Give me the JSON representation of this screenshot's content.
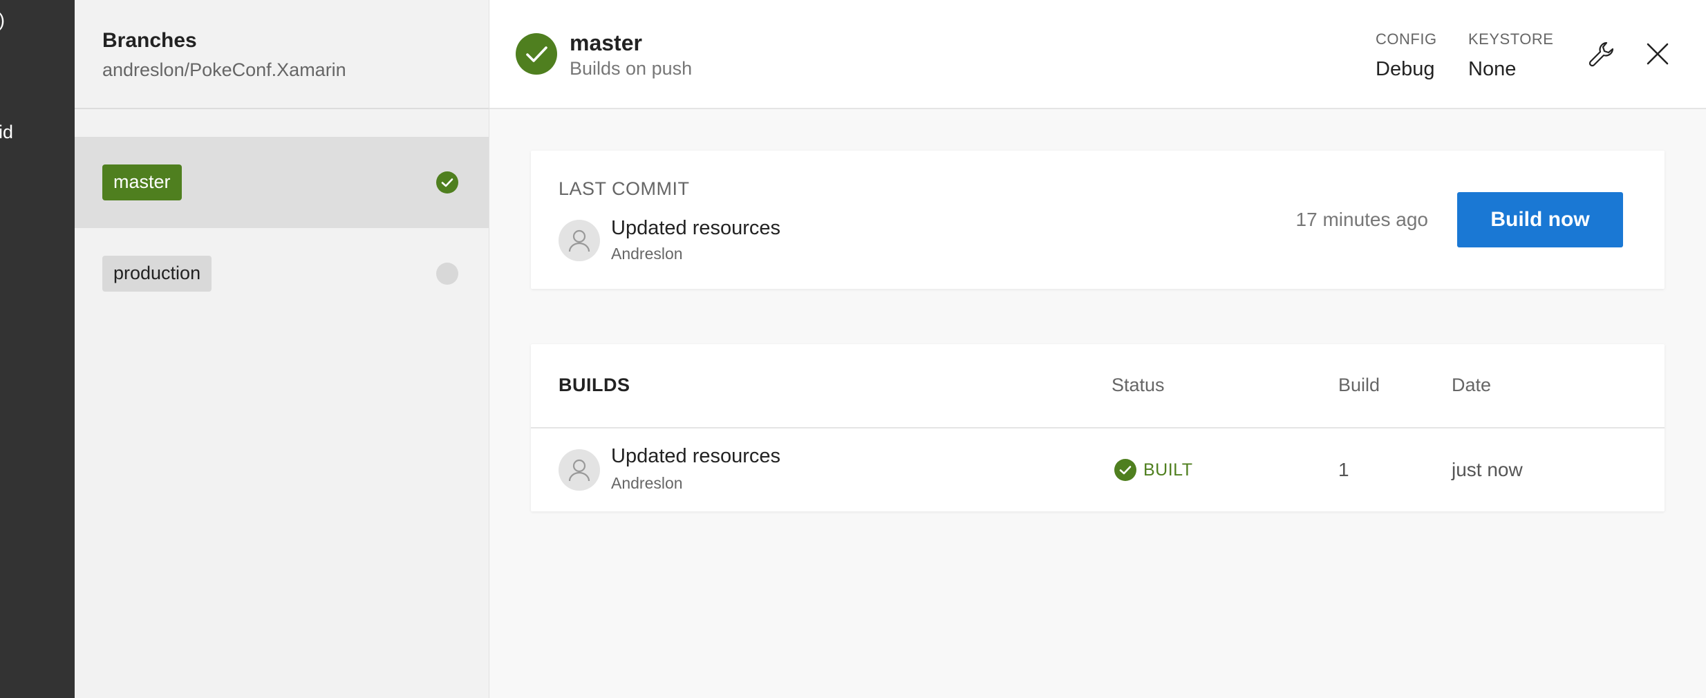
{
  "left_nav": {
    "fragment_1": ")",
    "fragment_2": "id"
  },
  "branches_panel": {
    "title": "Branches",
    "repo": "andreslon/PokeConf.Xamarin",
    "items": [
      {
        "name": "master",
        "status": "success",
        "selected": true
      },
      {
        "name": "production",
        "status": "none",
        "selected": false
      }
    ]
  },
  "header": {
    "branch": "master",
    "subtitle": "Builds on push",
    "config_label": "CONFIG",
    "config_value": "Debug",
    "keystore_label": "KEYSTORE",
    "keystore_value": "None",
    "icons": {
      "settings": "wrench-icon",
      "close": "close-icon",
      "status": "check-circle-icon"
    }
  },
  "last_commit": {
    "label": "LAST COMMIT",
    "message": "Updated resources",
    "author": "Andreslon",
    "time": "17 minutes ago",
    "build_button": "Build now"
  },
  "builds": {
    "title": "BUILDS",
    "columns": {
      "status": "Status",
      "build": "Build",
      "date": "Date"
    },
    "rows": [
      {
        "message": "Updated resources",
        "author": "Andreslon",
        "status": "BUILT",
        "build": "1",
        "date": "just now"
      }
    ]
  },
  "colors": {
    "success": "#4f7f1f",
    "primary": "#1a78d4",
    "nav_dark": "#333333"
  }
}
